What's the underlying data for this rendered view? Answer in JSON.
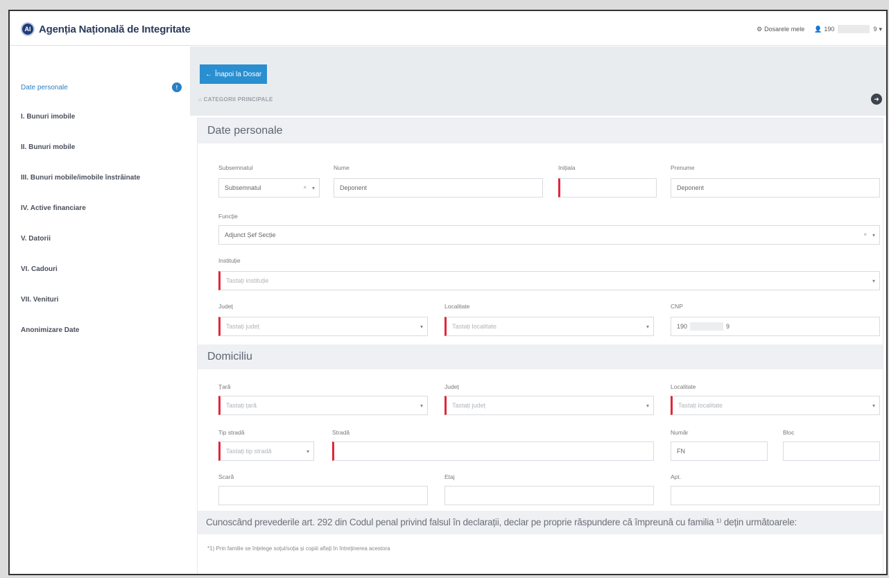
{
  "header": {
    "brand": "Agenția Națională de Integritate",
    "logo_text": "AI",
    "dossiers_label": "Dosarele mele",
    "user_id_start": "190",
    "user_id_end": "9"
  },
  "sidebar": {
    "items": [
      {
        "label": "Date personale",
        "active": true,
        "badge": "!"
      },
      {
        "label": "I. Bunuri imobile"
      },
      {
        "label": "II. Bunuri mobile"
      },
      {
        "label": "III. Bunuri mobile/imobile înstrăinate"
      },
      {
        "label": "IV. Active financiare"
      },
      {
        "label": "V. Datorii"
      },
      {
        "label": "VI. Cadouri"
      },
      {
        "label": "VII. Venituri"
      },
      {
        "label": "Anonimizare Date"
      }
    ]
  },
  "main": {
    "back_button": "Înapoi la Dosar",
    "categories_label": "CATEGORII PRINCIPALE",
    "section_personal": "Date personale",
    "section_domicile": "Domiciliu",
    "fields": {
      "subsemnatul_label": "Subsemnatul",
      "subsemnatul_value": "Subsemnatul",
      "nume_label": "Nume",
      "nume_value": "Deponent",
      "initiala_label": "Inițiala",
      "initiala_value": "",
      "prenume_label": "Prenume",
      "prenume_value": "Deponent",
      "functie_label": "Funcție",
      "functie_value": "Adjunct Șef Secție",
      "institutie_label": "Instituție",
      "institutie_placeholder": "Tastați instituție",
      "judet_label": "Județ",
      "judet_placeholder": "Tastați județ",
      "localitate_label": "Localitate",
      "localitate_placeholder": "Tastați localitate",
      "cnp_label": "CNP",
      "cnp_start": "190",
      "cnp_end": "9",
      "tara_label": "Țară",
      "tara_placeholder": "Tastați țară",
      "dom_judet_label": "Județ",
      "dom_judet_placeholder": "Tastați județ",
      "dom_localitate_label": "Localitate",
      "dom_localitate_placeholder": "Tastați localitate",
      "tip_strada_label": "Tip stradă",
      "tip_strada_placeholder": "Tastați tip stradă",
      "strada_label": "Stradă",
      "strada_value": "",
      "numar_label": "Număr",
      "numar_value": "FN",
      "bloc_label": "Bloc",
      "bloc_value": "",
      "scara_label": "Scară",
      "scara_value": "",
      "etaj_label": "Etaj",
      "etaj_value": "",
      "apt_label": "Apt.",
      "apt_value": ""
    },
    "declaration": "Cunoscând prevederile art. 292 din Codul penal privind falsul în declarații, declar pe proprie răspundere că împreună cu familia ¹⁾ dețin următoarele:",
    "footnote": "*1) Prin familie se înțelege soțul/soția și copiii aflați în întreținerea acestora"
  },
  "colors": {
    "accent": "#2a8fd0",
    "required": "#e0263a",
    "brand": "#1f3c7a"
  }
}
